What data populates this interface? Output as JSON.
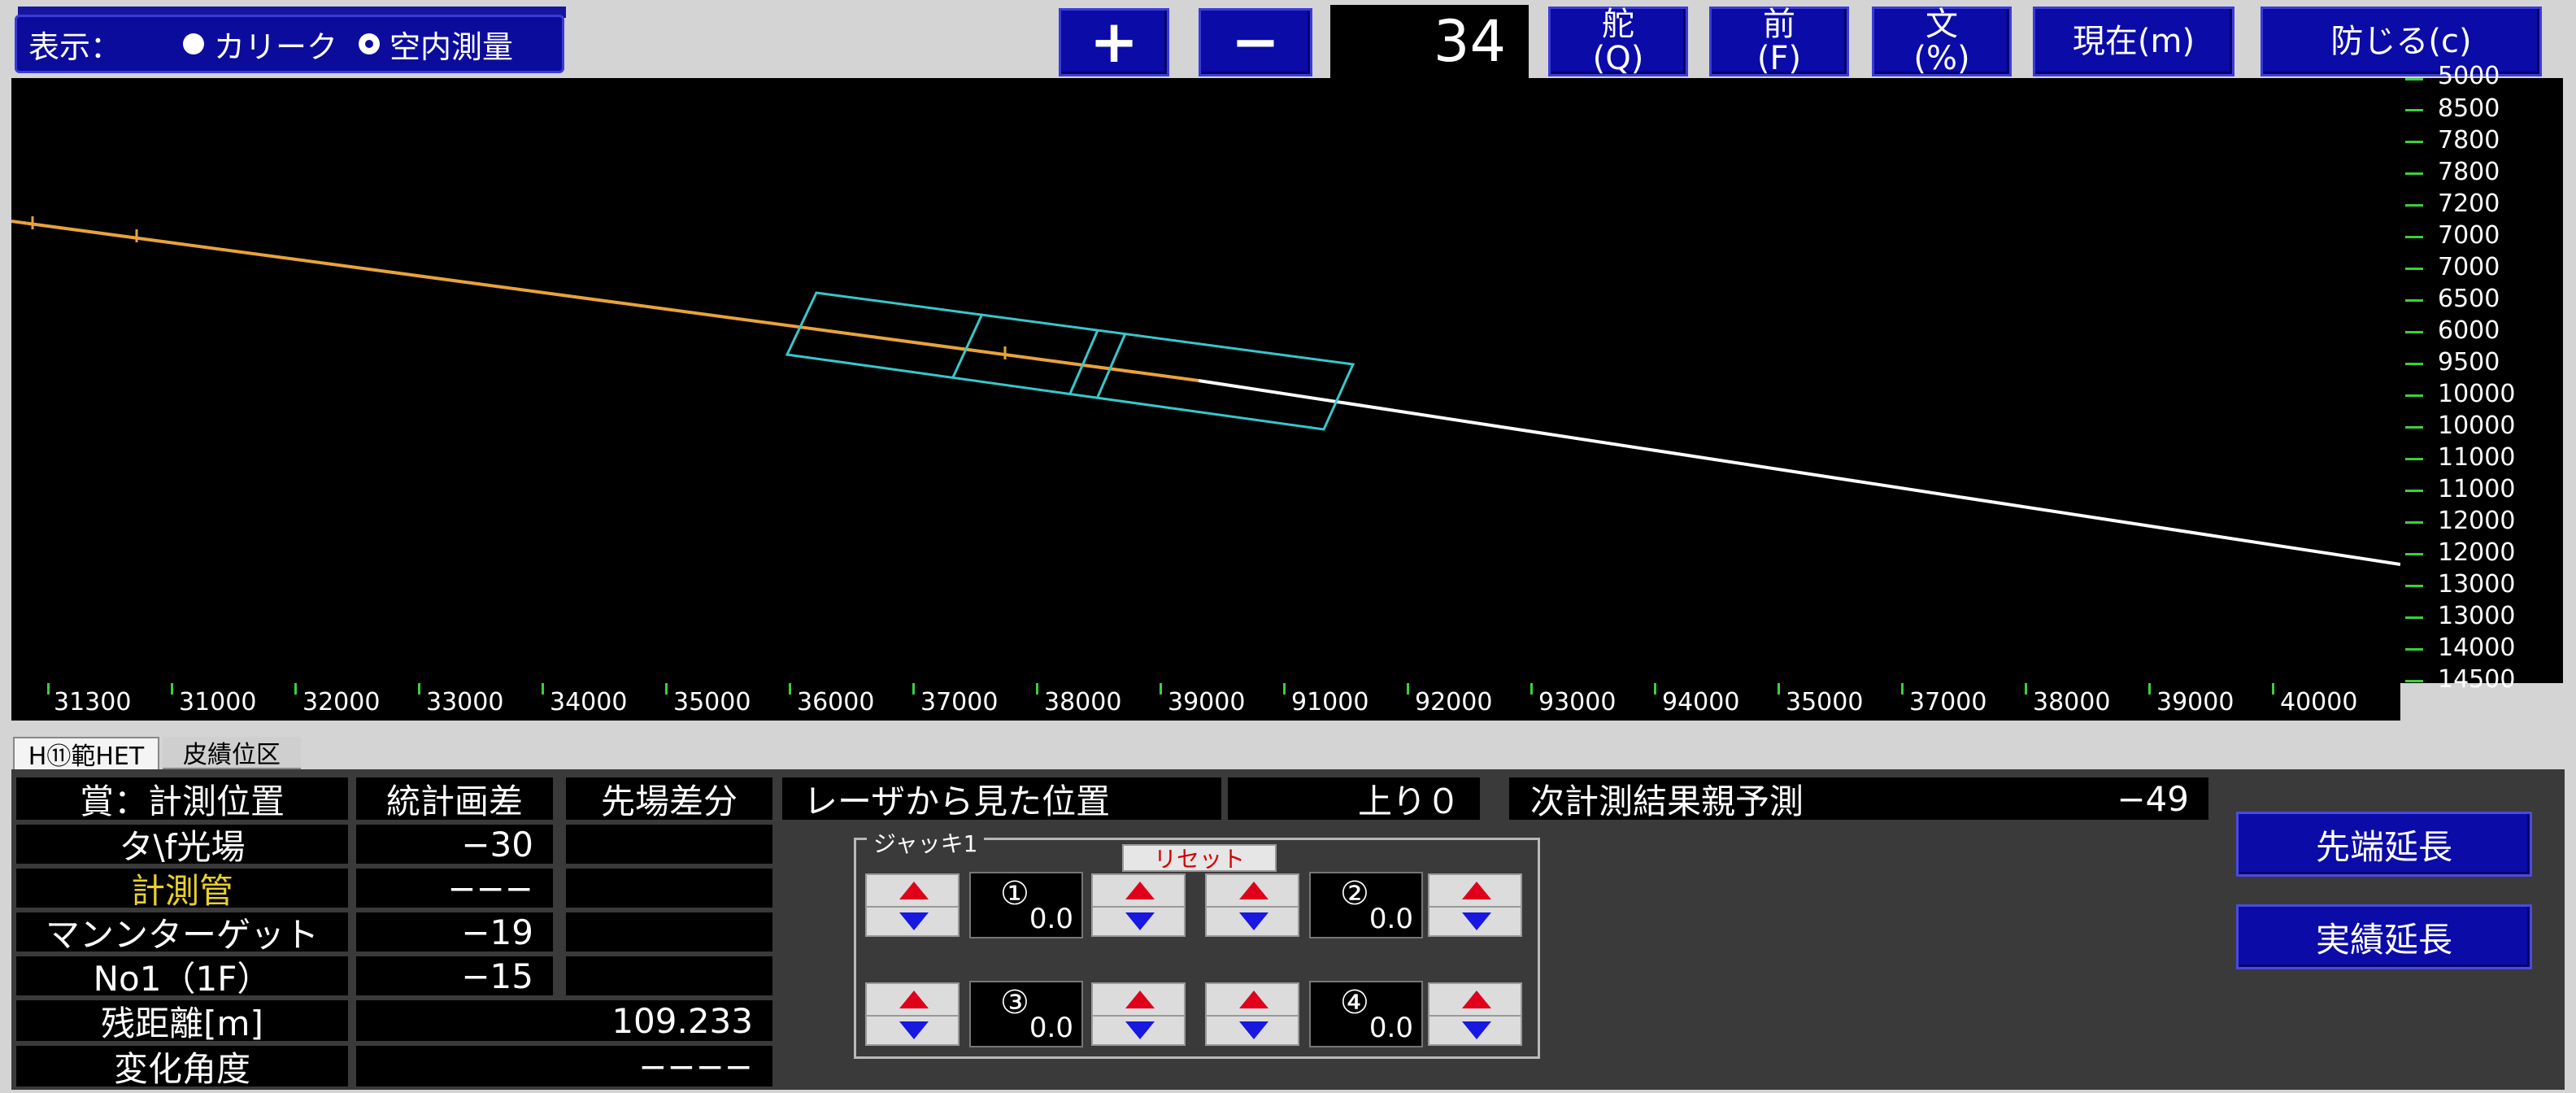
{
  "header": {
    "display_label": "表示：",
    "radio_options": [
      {
        "label": "カリーク",
        "selected": false
      },
      {
        "label": "空内測量",
        "selected": true
      }
    ],
    "zoom_in_label": "+",
    "zoom_out_label": "−",
    "zoom_value": "34",
    "buttons": [
      {
        "line1": "舵",
        "line2": "(Q)"
      },
      {
        "line1": "前",
        "line2": "(F)"
      },
      {
        "line1": "文",
        "line2": "(%)"
      }
    ],
    "current_label": "現在(m)",
    "close_label": "防じる(c)"
  },
  "plot": {
    "y_ticks": [
      "5000",
      "8500",
      "7800",
      "7800",
      "7200",
      "7000",
      "7000",
      "6500",
      "6000",
      "9500",
      "10000",
      "10000",
      "11000",
      "11000",
      "12000",
      "12000",
      "13000",
      "13000",
      "14000",
      "14500"
    ],
    "x_ticks": [
      "31300",
      "31000",
      "32000",
      "33000",
      "34000",
      "35000",
      "36000",
      "37000",
      "38000",
      "39000",
      "91000",
      "92000",
      "93000",
      "94000",
      "35000",
      "37000",
      "38000",
      "39000",
      "40000"
    ],
    "colors": {
      "background": "#000000",
      "measured_line": "#e8a33a",
      "plan_line": "#ffffff",
      "box": "#36c8cc",
      "tick": "#3ccf3c"
    }
  },
  "tabs": [
    {
      "label": "H⑪範HET",
      "active": true
    },
    {
      "label": "皮績位区",
      "active": false
    }
  ],
  "table": {
    "header": {
      "title": "賞：計測位置",
      "col1": "統計画差",
      "col2": "先場差分"
    },
    "rows": [
      {
        "label": "タ\\f光場",
        "v1": "−30",
        "v2": "",
        "highlight": false
      },
      {
        "label": "計測管",
        "v1": "−−−",
        "v2": "",
        "highlight": true
      },
      {
        "label": "マンンターゲット",
        "v1": "−19",
        "v2": "",
        "highlight": false
      },
      {
        "label": "No1（1F）",
        "v1": "−15",
        "v2": "",
        "highlight": false
      }
    ],
    "remaining": {
      "label": "残距離[m]",
      "value": "109.233"
    },
    "angle": {
      "label": "変化角度",
      "value": "−−−−"
    }
  },
  "laser": {
    "label": "レーザから見た位置",
    "value": "上り０"
  },
  "prediction": {
    "label": "次計測結果親予測",
    "value": "−49"
  },
  "jack": {
    "title": "ジャッキ1",
    "reset_label": "リセット",
    "units": [
      {
        "num": "①",
        "value": "0.0"
      },
      {
        "num": "②",
        "value": "0.0"
      },
      {
        "num": "③",
        "value": "0.0"
      },
      {
        "num": "④",
        "value": "0.0"
      }
    ]
  },
  "actions": {
    "tip_extend": "先端延長",
    "actual_extend": "実績延長"
  }
}
